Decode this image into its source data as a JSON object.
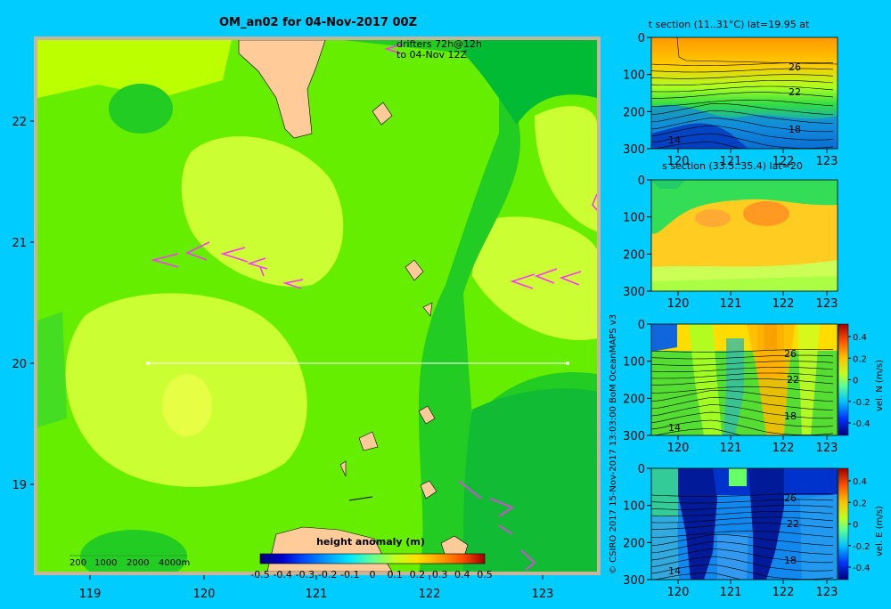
{
  "main_map": {
    "title": "OM_an02 for 04-Nov-2017 00Z",
    "drifters_note_line1": "drifters 72h@12h",
    "drifters_note_line2": "to 04-Nov 12Z",
    "lat_ticks": [
      "22",
      "21",
      "20",
      "19"
    ],
    "lon_ticks": [
      "119",
      "120",
      "121",
      "122",
      "123"
    ],
    "depth_legend": [
      "200",
      "1000",
      "2000",
      "4000m"
    ],
    "colorbar": {
      "label": "height anomaly (m)",
      "ticks": [
        "-0.5",
        "-0.4",
        "-0.3",
        "-0.2",
        "-0.1",
        "0",
        "0.1",
        "0.2",
        "0.3",
        "0.4",
        "0.5"
      ],
      "colors": [
        "#00007a",
        "#0000d0",
        "#0050ff",
        "#00a0ff",
        "#00e8ff",
        "#40ffd0",
        "#a0ff60",
        "#e8ff00",
        "#ffc000",
        "#ff7000",
        "#e02000",
        "#900000"
      ]
    },
    "section_line": {
      "lat": 20.0,
      "lon_start": 119.5,
      "lon_end": 123.2
    }
  },
  "credit": "© CSIRO 2017   15-Nov-2017 13:03:00 BoM OceanMAPS v3",
  "panels": [
    {
      "title": "t section (11..31°C) lat=19.95 at",
      "depth_ticks": [
        "0",
        "100",
        "200",
        "300"
      ],
      "lon_ticks": [
        "120",
        "121",
        "122",
        "123"
      ],
      "contour_labels": [
        "26",
        "22",
        "18",
        "14"
      ]
    },
    {
      "title": "s section (33.5..35.4) lat=20",
      "depth_ticks": [
        "0",
        "100",
        "200",
        "300"
      ],
      "lon_ticks": [
        "120",
        "121",
        "122",
        "123"
      ]
    },
    {
      "depth_ticks": [
        "0",
        "100",
        "200",
        "300"
      ],
      "lon_ticks": [
        "120",
        "121",
        "122",
        "123"
      ],
      "contour_labels": [
        "26",
        "22",
        "18",
        "14"
      ],
      "colorbar_ticks": [
        "0.4",
        "0.2",
        "0",
        "-0.2",
        "-0.4"
      ],
      "colorbar_label": "vel. N (m/s)"
    },
    {
      "depth_ticks": [
        "0",
        "100",
        "200",
        "300"
      ],
      "lon_ticks": [
        "120",
        "121",
        "122",
        "123"
      ],
      "contour_labels": [
        "26",
        "22",
        "18",
        "14"
      ],
      "colorbar_ticks": [
        "0.4",
        "0.2",
        "0",
        "-0.2",
        "-0.4"
      ],
      "colorbar_label": "vel. E (m/s)"
    }
  ],
  "colors": {
    "background": "#00ccff",
    "sea_level_zero": "#66ee00",
    "land": "#ffcc99",
    "drifter": "#ff33ff"
  }
}
